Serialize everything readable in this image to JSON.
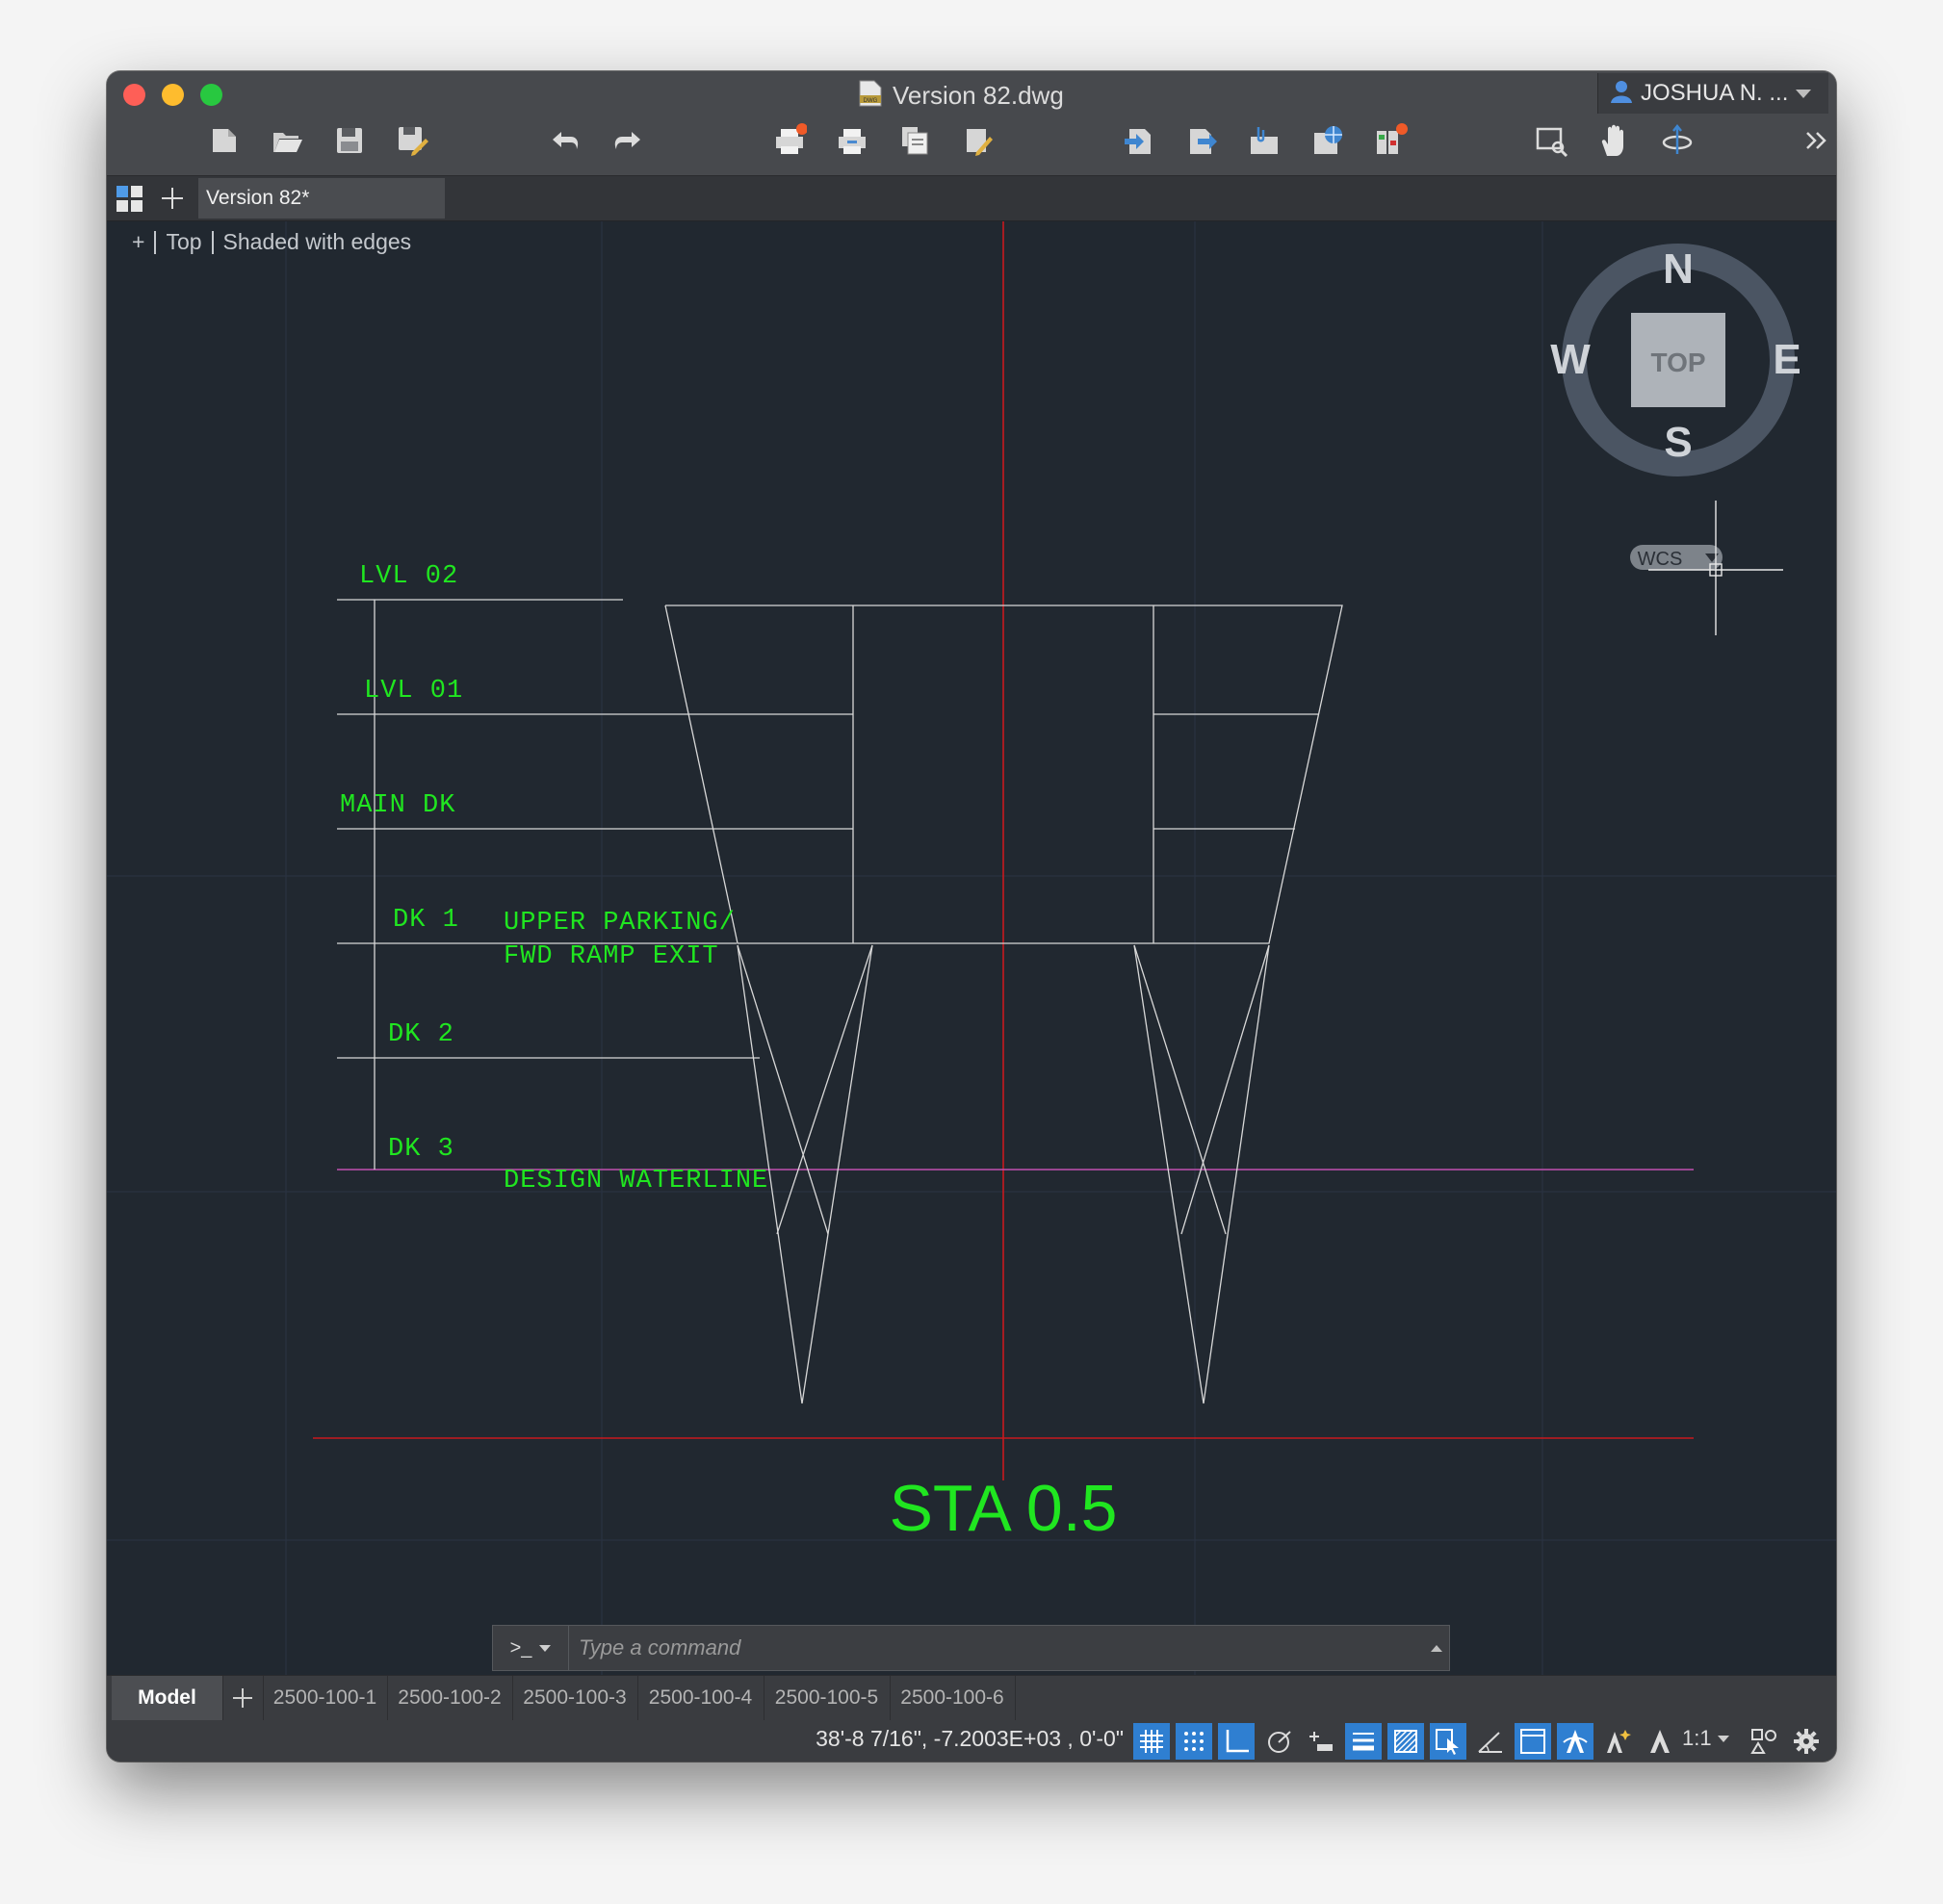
{
  "window": {
    "title": "Version 82.dwg",
    "user": "JOSHUA N. ..."
  },
  "toolbar": {
    "icons": [
      "new-icon",
      "open-icon",
      "save-icon",
      "save-as-icon",
      "undo-icon",
      "redo-icon",
      "plot-icon",
      "print-icon",
      "publish-icon",
      "edit-publish-icon",
      "import-icon",
      "export-icon",
      "attach-icon",
      "etransmit-icon",
      "drawing-set-icon",
      "layer-icon",
      "zoom-window-icon",
      "pan-icon",
      "orbit-icon",
      "more-icon"
    ]
  },
  "tabs": {
    "doc": "Version 82*"
  },
  "viewport": {
    "plus": "+",
    "view": "Top",
    "style": "Shaded with edges"
  },
  "viewcube": {
    "n": "N",
    "s": "S",
    "e": "E",
    "w": "W",
    "face": "TOP",
    "ucs": "WCS"
  },
  "drawing": {
    "levels": [
      "LVL 02",
      "LVL 01",
      "MAIN DK",
      "DK 1",
      "DK 2",
      "DK 3"
    ],
    "note1": "UPPER PARKING/",
    "note2": "FWD RAMP EXIT",
    "note3": "DESIGN WATERLINE",
    "station": "STA 0.5",
    "colors": {
      "text": "#20e620",
      "red": "#c8191e",
      "magenta": "#c050b0",
      "line": "#d8d8d8"
    }
  },
  "command": {
    "prompt": ">_",
    "placeholder": "Type a command"
  },
  "layouts": [
    "Model",
    "2500-100-1",
    "2500-100-2",
    "2500-100-3",
    "2500-100-4",
    "2500-100-5",
    "2500-100-6"
  ],
  "status": {
    "coords": "38'-8 7/16\",  -7.2003E+03 , 0'-0\"",
    "scale": "1:1"
  }
}
